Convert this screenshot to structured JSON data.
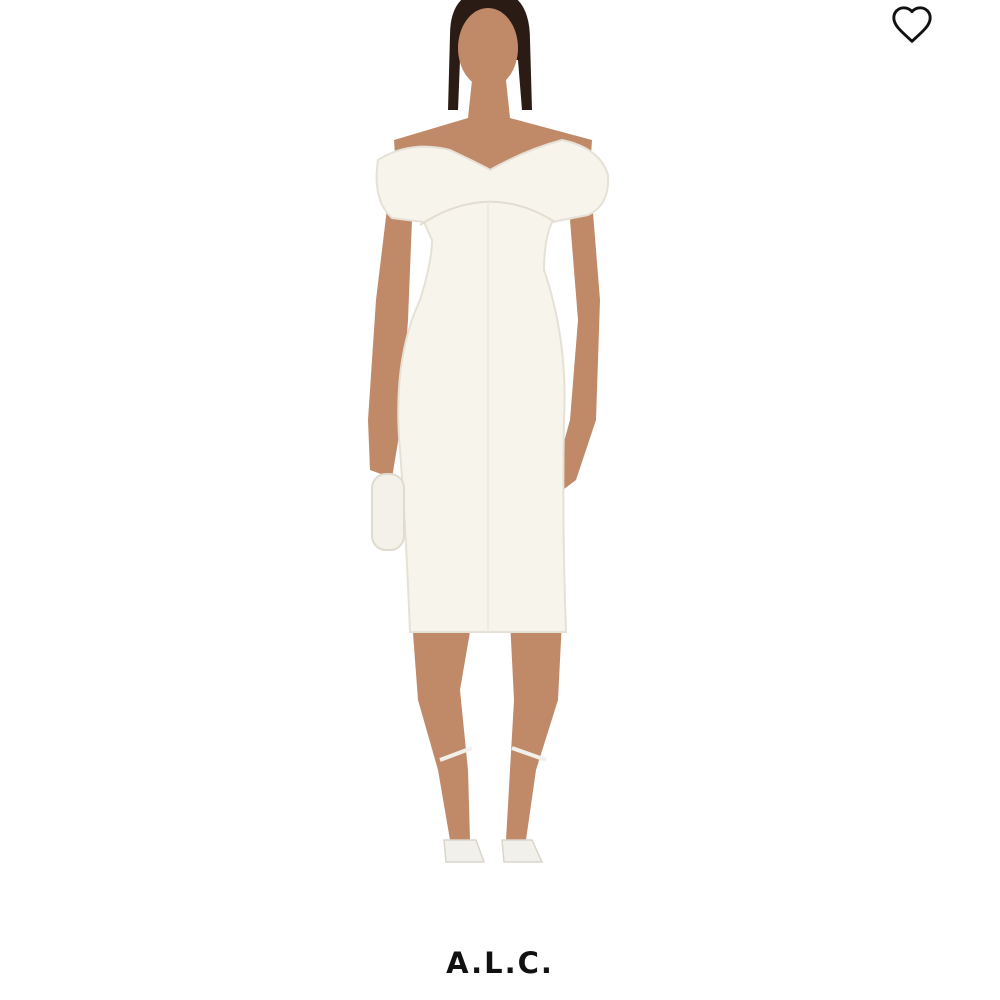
{
  "product": {
    "brand": "A.L.C.",
    "image_label": "product-photo",
    "wishlist_icon": "heart-outline-icon",
    "colors": {
      "background": "#ffffff",
      "text": "#111111",
      "dress": "#f7f4ec",
      "skin": "#c08a68"
    }
  }
}
